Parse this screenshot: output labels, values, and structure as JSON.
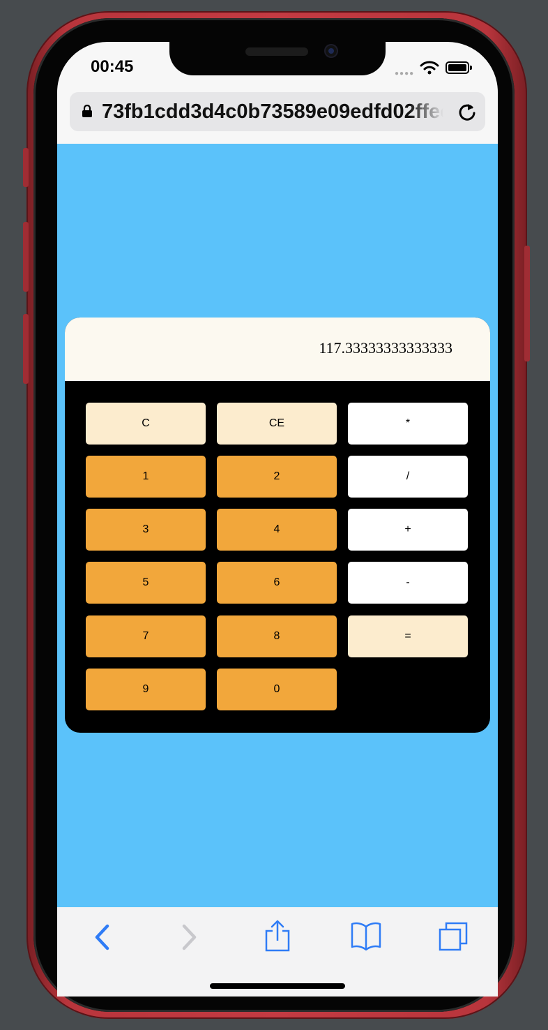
{
  "status_bar": {
    "time": "00:45"
  },
  "browser": {
    "url": "73fb1cdd3d4c0b73589e09edfd02ffec"
  },
  "calculator": {
    "display": "117.33333333333333",
    "keys": {
      "clear": "C",
      "clear_entry": "CE",
      "multiply": "*",
      "one": "1",
      "two": "2",
      "divide": "/",
      "three": "3",
      "four": "4",
      "plus": "+",
      "five": "5",
      "six": "6",
      "minus": "-",
      "seven": "7",
      "eight": "8",
      "equals": "=",
      "nine": "9",
      "zero": "0"
    }
  },
  "colors": {
    "page_background": "#5bc2fa",
    "display_background": "#fcf9f0",
    "key_cream": "#fcecce",
    "key_orange": "#f2a73b",
    "key_white": "#ffffff",
    "safari_blue": "#2f7cf6"
  }
}
